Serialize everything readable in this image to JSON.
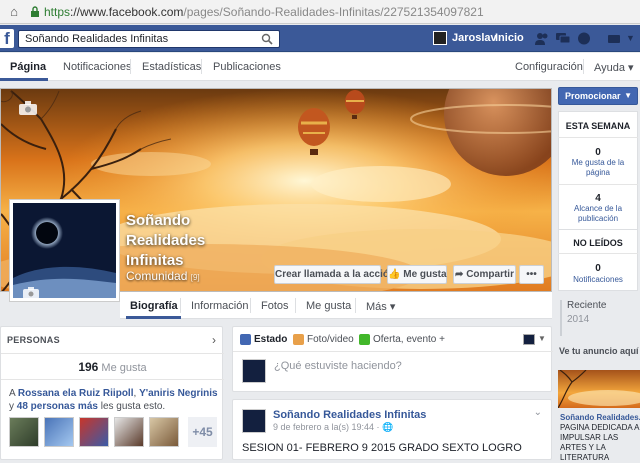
{
  "browser": {
    "url_scheme": "https",
    "url_host": "://www.facebook.com",
    "url_path": "/pages/Soñando-Realidades-Infinitas/227521354097821"
  },
  "topbar": {
    "search_value": "Soñando Realidades Infinitas",
    "user_name": "Jaroslav",
    "home_label": "Inicio",
    "brand_color": "#3b5998"
  },
  "page_nav": {
    "tabs": [
      "Página",
      "Notificaciones",
      "Estadísticas",
      "Publicaciones"
    ],
    "settings": "Configuración",
    "help": "Ayuda ▾"
  },
  "page": {
    "title": "Soñando Realidades Infinitas",
    "category": "Comunidad",
    "category_badge": "[9]",
    "buttons": {
      "call": "Crear llamada a la acción",
      "like": "Me gusta",
      "share": "Compartir",
      "more": "•••"
    },
    "sections": [
      "Biografía",
      "Información",
      "Fotos",
      "Me gusta",
      "Más ▾"
    ]
  },
  "personas": {
    "header": "PERSONAS",
    "likes_count": "196",
    "likes_label": "Me gusta",
    "friends_prefix": "A ",
    "friend_links": "Rossana ela Ruiz Riipoll",
    "friends_sep": ", ",
    "friend_links2": "Y'aniris Negrinis",
    "friends_mid": " y ",
    "friends_more": "48 personas más",
    "friends_suffix": " les gusta esto.",
    "more_badge": "+45"
  },
  "composer": {
    "status": "Estado",
    "photo": "Foto/video",
    "offer": "Oferta, evento +",
    "placeholder": "¿Qué estuviste haciendo?"
  },
  "post": {
    "author": "Soñando Realidades Infinitas",
    "date": "9 de febrero a la(s) 19:44 · ",
    "text": "SESION 01- FEBRERO 9 2015 GRADO SEXTO LOGRO"
  },
  "sidebar": {
    "promote": "Promocionar",
    "week_title": "ESTA SEMANA",
    "stat1_value": "0",
    "stat1_label": "Me gusta de la página",
    "stat2_value": "4",
    "stat2_label": "Alcance de la publicación",
    "unread_title": "NO LEÍDOS",
    "stat3_value": "0",
    "stat3_label": "Notificaciones",
    "timeline_recent": "Reciente",
    "timeline_year": "2014",
    "ad_header": "Ve tu anuncio aquí",
    "ad_title": "Soñando Realidades...",
    "ad_text": "PAGINA DEDICADA A IMPULSAR LAS ARTES Y LA LITERATURA"
  }
}
